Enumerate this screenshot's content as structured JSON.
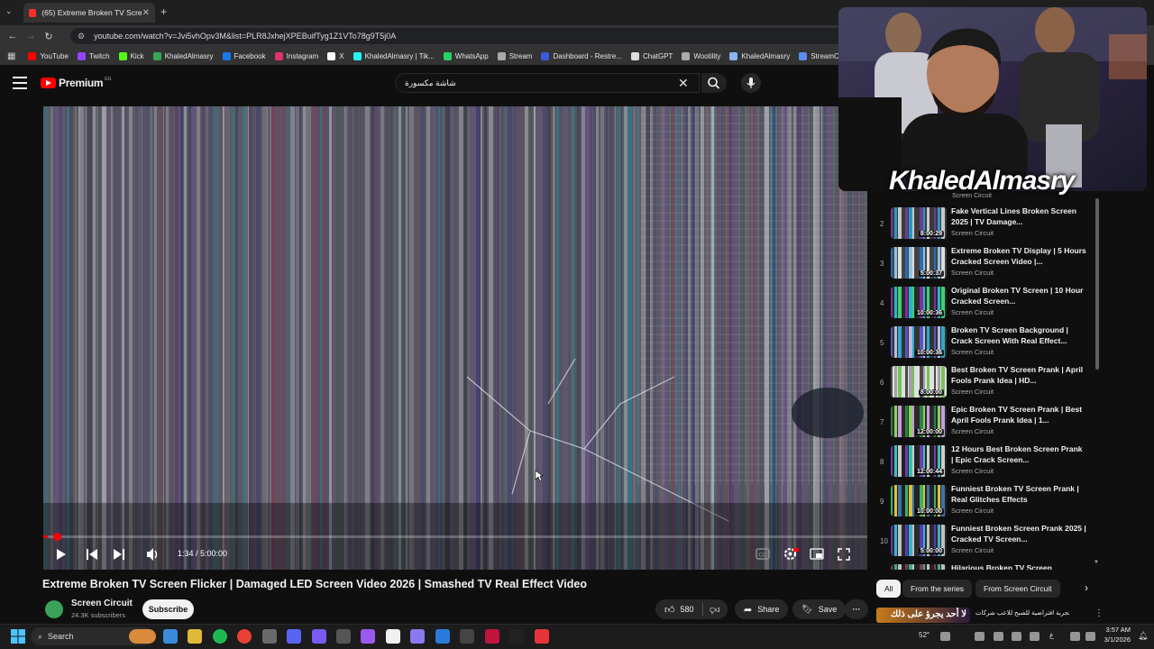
{
  "browser": {
    "tab_title": "(65) Extreme Broken TV Screen",
    "url": "youtube.com/watch?v=Jvi5vhOpv3M&list=PLR8JxhejXPEBuifTyg1Z1VTo78g9T5j0A",
    "new_tab": "+",
    "bookmarks": [
      {
        "label": "YouTube",
        "color": "#ff0000"
      },
      {
        "label": "Twitch",
        "color": "#9146ff"
      },
      {
        "label": "Kick",
        "color": "#53fc18"
      },
      {
        "label": "KhaledAlmasry",
        "color": "#34a853"
      },
      {
        "label": "Facebook",
        "color": "#1877f2"
      },
      {
        "label": "Instagram",
        "color": "#e1306c"
      },
      {
        "label": "X",
        "color": "#ffffff"
      },
      {
        "label": "KhaledAlmasry | Tik...",
        "color": "#25f4ee"
      },
      {
        "label": "WhatsApp",
        "color": "#25d366"
      },
      {
        "label": "Stream",
        "color": "#aaaaaa"
      },
      {
        "label": "Dashboard - Restre...",
        "color": "#3b5bdb"
      },
      {
        "label": "ChatGPT",
        "color": "#dddddd"
      },
      {
        "label": "Wootility",
        "color": "#aaaaaa"
      },
      {
        "label": "KhaledAlmasry",
        "color": "#8ab4f8"
      },
      {
        "label": "StreamCharts",
        "color": "#5b8def"
      }
    ]
  },
  "youtube": {
    "logo_word": "Premium",
    "logo_badge": "EG",
    "search_query": "شاشة مكسورة",
    "player": {
      "time": "1:34 / 5:00:00",
      "progress": 0.0052
    },
    "video_title": "Extreme Broken TV Screen Flicker | Damaged LED Screen Video 2026 | Smashed TV Real Effect Video",
    "channel_name": "Screen Circuit",
    "subscribers": "24.3K subscribers",
    "subscribe_label": "Subscribe",
    "likes": "580",
    "share_label": "Share",
    "save_label": "Save",
    "more_label": "···"
  },
  "webcam": {
    "streamer_name": "KhaledAlmasry",
    "peek_text": "Screen Circuit"
  },
  "playlist": {
    "items": [
      {
        "num": "2",
        "title": "Fake Vertical Lines Broken Screen 2025 | TV Damage...",
        "channel": "Screen Circuit",
        "duration": "8:00:29"
      },
      {
        "num": "3",
        "title": "Extreme Broken TV Display | 5 Hours Cracked Screen Video |...",
        "channel": "Screen Circuit",
        "duration": "5:00:37"
      },
      {
        "num": "4",
        "title": "Original Broken TV Screen | 10 Hour Cracked Screen...",
        "channel": "Screen Circuit",
        "duration": "10:00:36"
      },
      {
        "num": "5",
        "title": "Broken TV Screen Background | Crack Screen With Real Effect...",
        "channel": "Screen Circuit",
        "duration": "10:00:36"
      },
      {
        "num": "6",
        "title": "Best Broken TV Screen Prank | April Fools Prank Idea | HD...",
        "channel": "Screen Circuit",
        "duration": "8:00:00"
      },
      {
        "num": "7",
        "title": "Epic Broken TV Screen Prank | Best April Fools Prank Idea | 1...",
        "channel": "Screen Circuit",
        "duration": "12:00:00"
      },
      {
        "num": "8",
        "title": "12 Hours Best Broken Screen Prank | Epic Crack Screen...",
        "channel": "Screen Circuit",
        "duration": "12:00:44"
      },
      {
        "num": "9",
        "title": "Funniest Broken TV Screen Prank | Real Glitches Effects",
        "channel": "Screen Circuit",
        "duration": "10:00:00"
      },
      {
        "num": "10",
        "title": "Funniest Broken Screen Prank 2025 | Cracked TV Screen...",
        "channel": "Screen Circuit",
        "duration": "5:00:00"
      },
      {
        "num": "",
        "title": "Hilarious Broken TV Screen",
        "channel": "",
        "duration": ""
      }
    ]
  },
  "chips": {
    "all": "All",
    "series": "From the series",
    "channel": "From Screen Circuit"
  },
  "promo": {
    "badge": "لا أحد يجرؤ على ذلك",
    "text": "تجربة افتراضية للصبح للاعب شركات"
  },
  "taskbar": {
    "search_label": "Search",
    "tray_count": "52",
    "tray_lang": "ع",
    "time": "3:57 AM",
    "date": "3/1/2026"
  }
}
